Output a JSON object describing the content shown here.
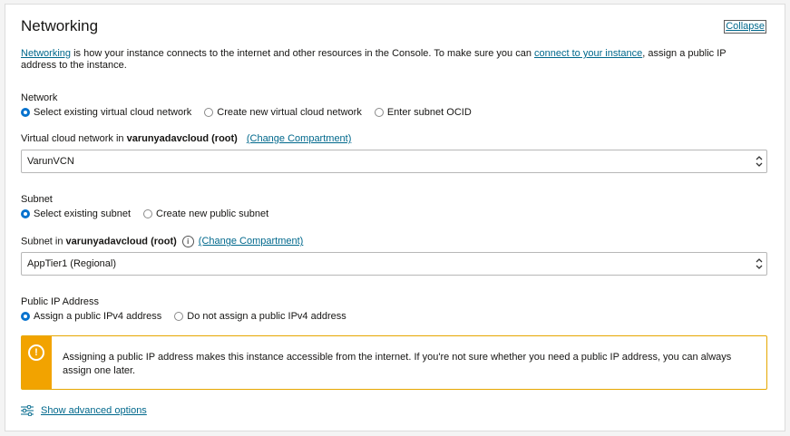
{
  "section": {
    "title": "Networking",
    "collapse_label": "Collapse"
  },
  "intro": {
    "link1": "Networking",
    "text1": " is how your instance connects to the internet and other resources in the Console. To make sure you can ",
    "link2": "connect to your instance",
    "text2": ", assign a public IP address to the instance."
  },
  "network": {
    "label": "Network",
    "options": [
      "Select existing virtual cloud network",
      "Create new virtual cloud network",
      "Enter subnet OCID"
    ],
    "selected": 0
  },
  "vcn": {
    "label_prefix": "Virtual cloud network in ",
    "label_bold": "varunyadavcloud (root)",
    "change_link": "(Change Compartment)",
    "value": "VarunVCN"
  },
  "subnet": {
    "label": "Subnet",
    "options": [
      "Select existing subnet",
      "Create new public subnet"
    ],
    "selected": 0,
    "label_prefix": "Subnet in ",
    "label_bold": "varunyadavcloud (root)",
    "change_link": "(Change Compartment)",
    "value": "AppTier1 (Regional)"
  },
  "public_ip": {
    "label": "Public IP Address",
    "options": [
      "Assign a public IPv4 address",
      "Do not assign a public IPv4 address"
    ],
    "selected": 0
  },
  "warning": {
    "text": "Assigning a public IP address makes this instance accessible from the internet. If you're not sure whether you need a public IP address, you can always assign one later."
  },
  "advanced": {
    "label": "Show advanced options"
  },
  "colors": {
    "link": "#00688c",
    "radio_selected": "#0572ce",
    "warning_bar": "#f2a300"
  }
}
